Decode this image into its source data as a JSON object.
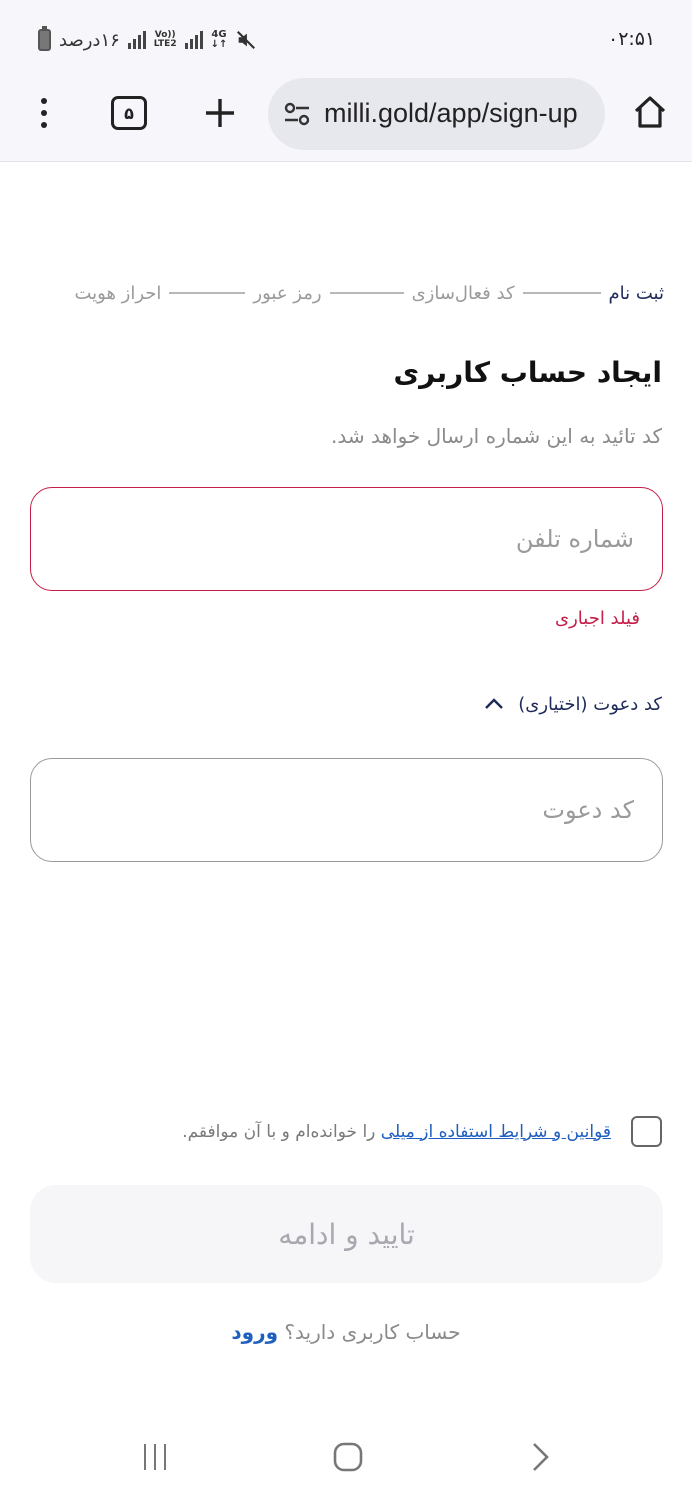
{
  "status_bar": {
    "time": "۰۲:۵۱",
    "battery": "۱۶درصد",
    "volte_label": "Vo))",
    "lte_label": "LTE2",
    "network": "4G",
    "icons": [
      "battery-icon",
      "signal-icon",
      "volte-icon",
      "4g-icon",
      "mute-icon"
    ]
  },
  "browser": {
    "url": "milli.gold/app/sign-up",
    "tab_count": "۵",
    "icons": [
      "more-vert-icon",
      "tabs-icon",
      "plus-icon",
      "tune-icon",
      "home-icon"
    ]
  },
  "stepper": {
    "steps": [
      {
        "label": "ثبت نام",
        "active": true
      },
      {
        "label": "کد فعال‌سازی",
        "active": false
      },
      {
        "label": "رمز عبور",
        "active": false
      },
      {
        "label": "احراز هویت",
        "active": false
      }
    ]
  },
  "form": {
    "title": "ایجاد حساب کاربری",
    "subtitle": "کد تائید به این شماره ارسال خواهد شد.",
    "phone_placeholder": "شماره تلفن",
    "phone_value": "",
    "phone_error": "فیلد اجباری",
    "invite_toggle_label": "کد دعوت (اختیاری)",
    "invite_placeholder": "کد دعوت",
    "invite_value": "",
    "terms_link": "قوانین و شرایط استفاده از میلی",
    "terms_suffix": " را خوانده‌ام و با آن موافقم.",
    "terms_checked": false,
    "submit_label": "تایید و ادامه",
    "login_prompt": "حساب کاربری دارید؟ ",
    "login_link": "ورود"
  },
  "colors": {
    "accent": "#1f5fbf",
    "error": "#c51d46",
    "active_step": "#1e2a5a",
    "disabled_button_bg": "#f6f6f9"
  }
}
